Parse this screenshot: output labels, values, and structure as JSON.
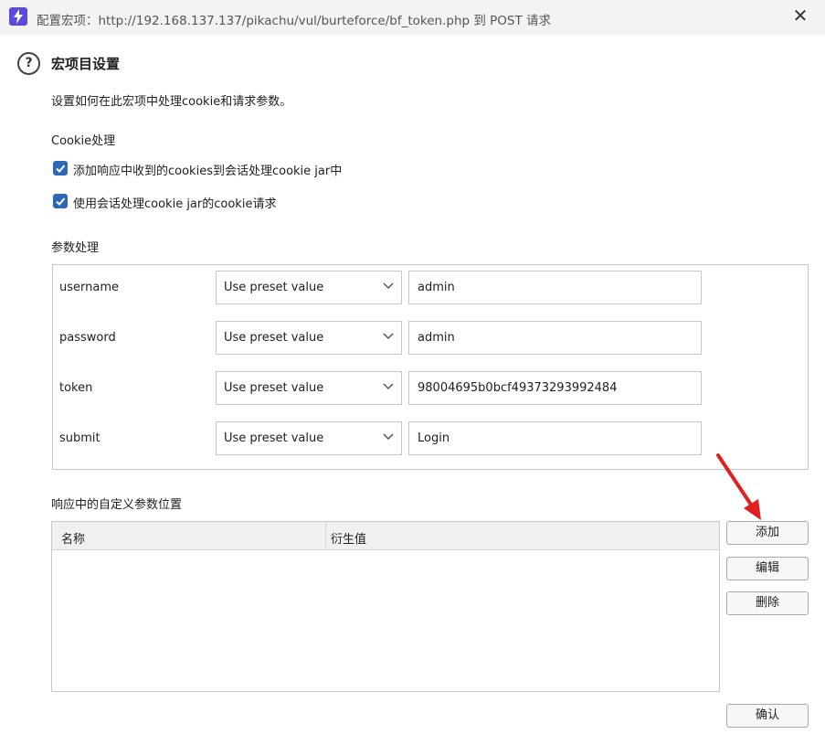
{
  "window": {
    "title": "配置宏项：http://192.168.137.137/pikachu/vul/burteforce/bf_token.php 到 POST 请求",
    "close_glyph": "✕"
  },
  "dialog": {
    "help_glyph": "?",
    "heading": "宏项目设置",
    "description": "设置如何在此宏项中处理cookie和请求参数。"
  },
  "cookie_section": {
    "label": "Cookie处理",
    "options": [
      {
        "label": "添加响应中收到的cookies到会话处理cookie jar中",
        "checked": true
      },
      {
        "label": "使用会话处理cookie jar的cookie请求",
        "checked": true
      }
    ]
  },
  "param_section": {
    "label": "参数处理",
    "params": [
      {
        "name": "username",
        "mode": "Use preset value",
        "value": "admin"
      },
      {
        "name": "password",
        "mode": "Use preset value",
        "value": "admin"
      },
      {
        "name": "token",
        "mode": "Use preset value",
        "value": "98004695b0bcf49373293992484"
      },
      {
        "name": "submit",
        "mode": "Use preset value",
        "value": "Login"
      }
    ]
  },
  "custom_section": {
    "label": "响应中的自定义参数位置",
    "columns": [
      "名称",
      "衍生值"
    ]
  },
  "buttons": {
    "add": "添加",
    "edit": "编辑",
    "delete": "删除",
    "ok": "确认"
  },
  "colors": {
    "checkbox": "#2e66b8",
    "annotation_arrow": "#e02020",
    "app_icon": "#5b4bdb"
  }
}
